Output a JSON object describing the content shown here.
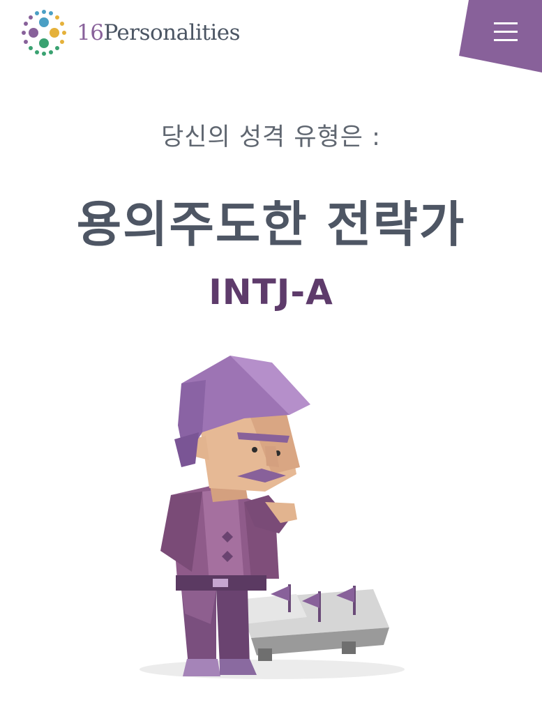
{
  "header": {
    "logo_number": "16",
    "logo_word": "Personalities",
    "menu_icon": "hamburger-menu-icon",
    "menu_color": "#88619a"
  },
  "result": {
    "subtitle": "당신의 성격 유형은 :",
    "type_name": "용의주도한 전략가",
    "type_code": "INTJ-A"
  },
  "illustration": {
    "icon": "intj-architect-character-illustration"
  },
  "colors": {
    "brand_purple": "#88619a",
    "title_gray": "#4e5664",
    "code_purple": "#5e3b6b"
  }
}
